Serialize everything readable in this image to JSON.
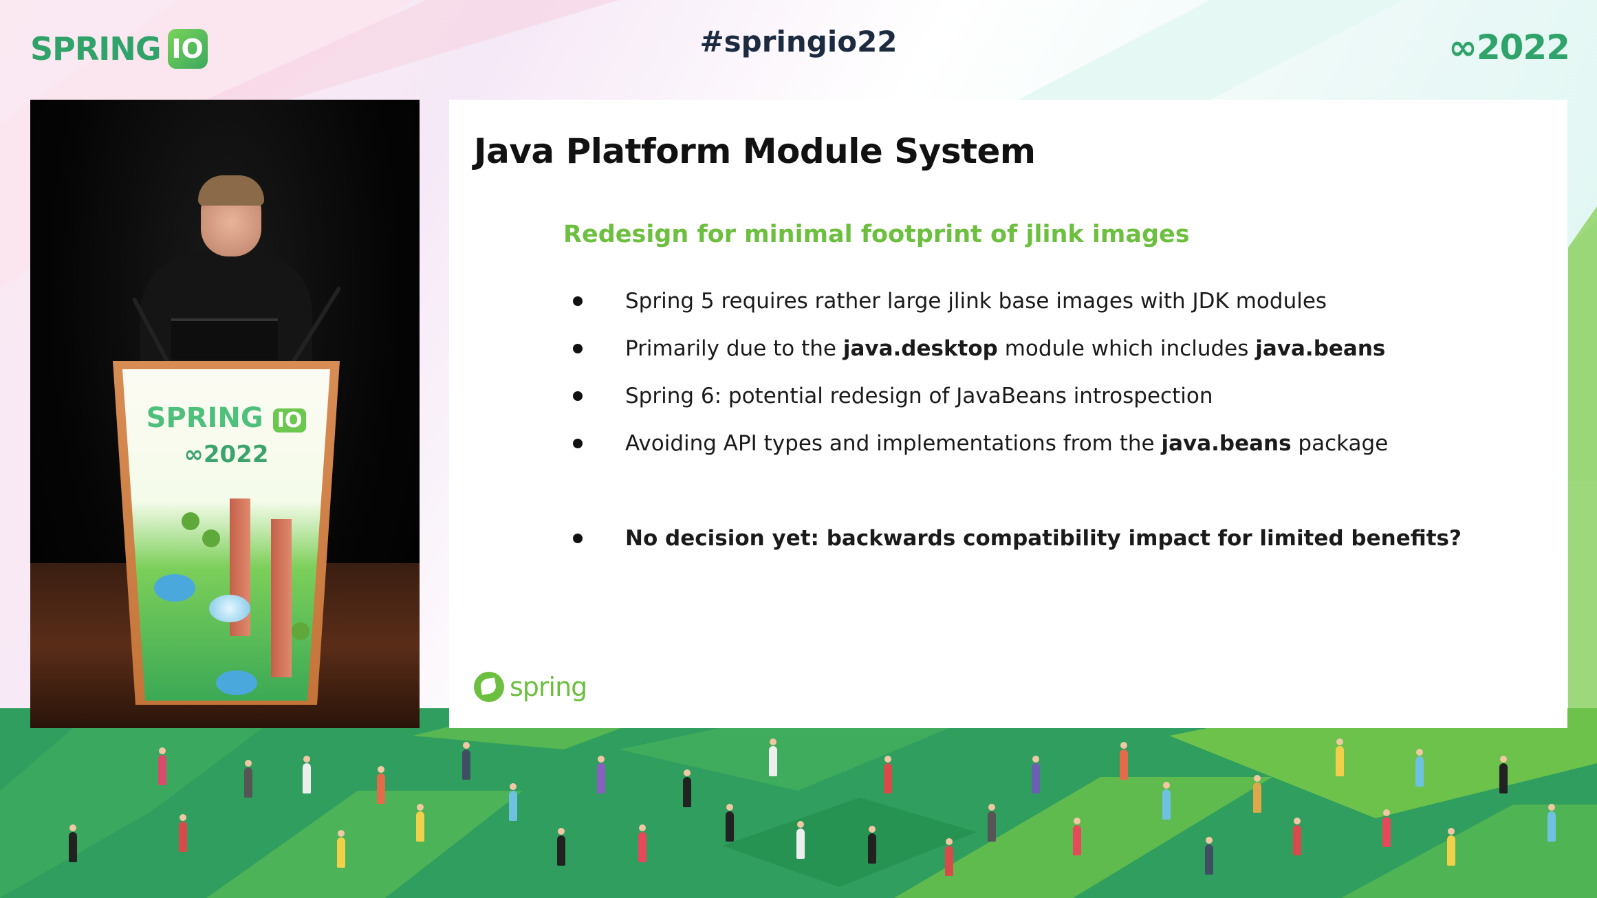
{
  "header": {
    "brand": "SPRING",
    "brand_badge": "IO",
    "hashtag": "#springio22",
    "year": "2022"
  },
  "speaker_video": {
    "podium_brand": "SPRING",
    "podium_badge": "IO",
    "podium_year": "2022"
  },
  "slide": {
    "title": "Java Platform Module System",
    "subtitle": "Redesign for minimal footprint of jlink images",
    "bullets": [
      {
        "parts": [
          {
            "text": "Spring 5 requires rather large jlink base images with JDK modules",
            "bold": false
          }
        ]
      },
      {
        "parts": [
          {
            "text": "Primarily due to the ",
            "bold": false
          },
          {
            "text": "java.desktop",
            "bold": true
          },
          {
            "text": " module which includes ",
            "bold": false
          },
          {
            "text": "java.beans",
            "bold": true
          }
        ]
      },
      {
        "parts": [
          {
            "text": "Spring 6: potential redesign of JavaBeans introspection",
            "bold": false
          }
        ]
      },
      {
        "parts": [
          {
            "text": "Avoiding API types and implementations from the ",
            "bold": false
          },
          {
            "text": "java.beans",
            "bold": true
          },
          {
            "text": " package",
            "bold": false
          }
        ]
      }
    ],
    "final_bullet": "No decision yet: backwards compatibility impact for limited benefits?",
    "footer_logo": "spring"
  },
  "colors": {
    "brand_green": "#2fa36a",
    "subtitle_green": "#6dbf3f",
    "ground_dark": "#2e9a5c",
    "ground_light": "#5cb84a"
  }
}
